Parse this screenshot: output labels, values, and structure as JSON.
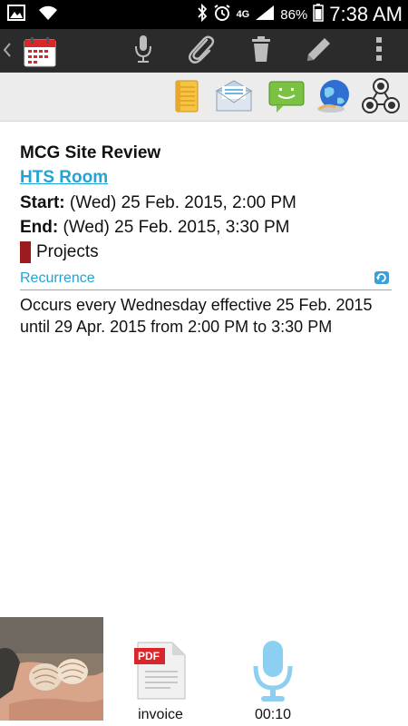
{
  "status_bar": {
    "network": "4G",
    "battery": "86%",
    "time": "7:38 AM"
  },
  "event": {
    "title": "MCG Site Review",
    "location": "HTS Room",
    "start_label": "Start:",
    "start_value": "(Wed) 25 Feb. 2015, 2:00 PM",
    "end_label": "End:",
    "end_value": "(Wed) 25 Feb. 2015, 3:30 PM",
    "category": "Projects",
    "category_color": "#9b1b1e",
    "recurrence_label": "Recurrence",
    "recurrence_text": "Occurs every Wednesday effective 25 Feb. 2015 until 29 Apr. 2015 from 2:00 PM to 3:30 PM"
  },
  "attachments": [
    {
      "type": "photo",
      "label": ""
    },
    {
      "type": "pdf",
      "label": "invoice"
    },
    {
      "type": "audio",
      "label": "00:10"
    }
  ],
  "pdf_badge": "PDF",
  "colors": {
    "accent": "#21a3d6",
    "action_bar": "#2b2b2b"
  }
}
